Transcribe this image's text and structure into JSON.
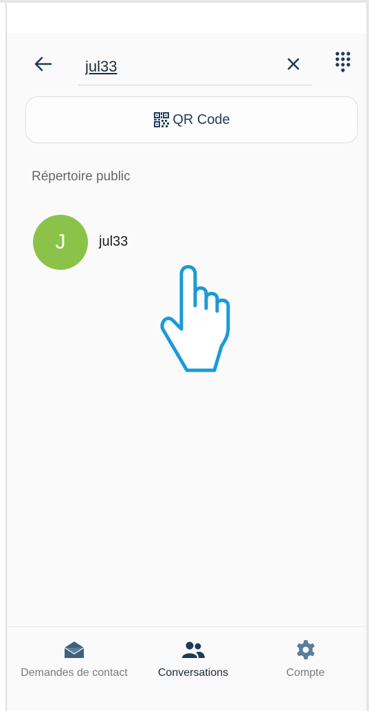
{
  "search": {
    "query": "jul33",
    "back_icon": "arrow-left-icon",
    "clear_icon": "close-icon",
    "dialpad_icon": "dialpad-icon"
  },
  "qr": {
    "label": "QR Code",
    "icon": "qr-code-icon"
  },
  "directory": {
    "title": "Répertoire public",
    "results": [
      {
        "initial": "J",
        "name": "jul33",
        "avatar_color": "#8bc34a"
      }
    ]
  },
  "bottom_nav": {
    "items": [
      {
        "label": "Demandes de contact",
        "icon": "envelope-open-icon",
        "active": false
      },
      {
        "label": "Conversations",
        "icon": "people-icon",
        "active": true
      },
      {
        "label": "Compte",
        "icon": "gear-icon",
        "active": false
      }
    ]
  },
  "colors": {
    "accent": "#1e3a5a",
    "avatar": "#8bc34a",
    "pointer": "#1a9bd7"
  }
}
